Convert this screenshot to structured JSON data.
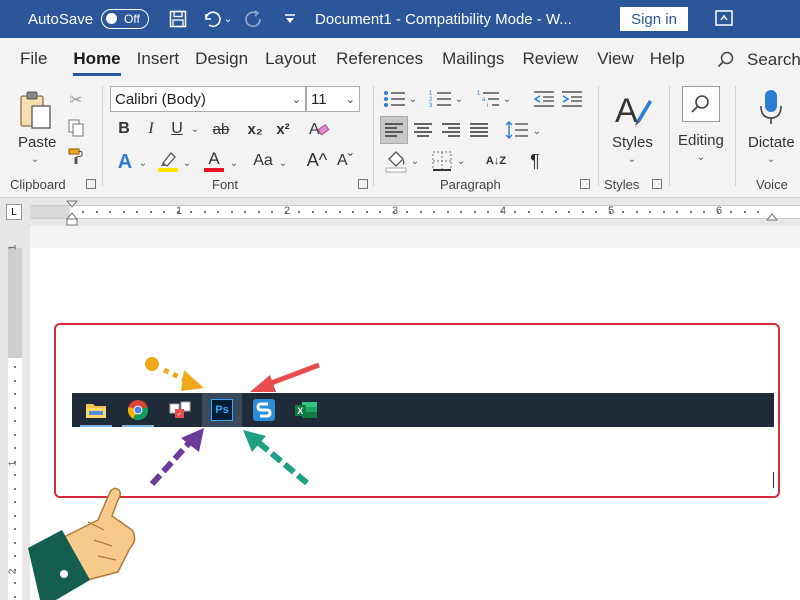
{
  "titlebar": {
    "autosave_label": "AutoSave",
    "autosave_state": "Off",
    "document_title": "Document1  -  Compatibility Mode  -  W...",
    "signin_label": "Sign in"
  },
  "tabs": {
    "items": [
      "File",
      "Home",
      "Insert",
      "Design",
      "Layout",
      "References",
      "Mailings",
      "Review",
      "View",
      "Help"
    ],
    "active": "Home",
    "search_label": "Search"
  },
  "ribbon": {
    "clipboard": {
      "label": "Clipboard",
      "paste_label": "Paste"
    },
    "font": {
      "label": "Font",
      "font_name": "Calibri (Body)",
      "font_size": "11",
      "bold": "B",
      "italic": "I",
      "underline": "U",
      "strike": "ab",
      "subscript": "x₂",
      "superscript": "x²",
      "font_color_glyph": "A",
      "case_glyph": "Aa",
      "grow_glyph": "A^",
      "shrink_glyph": "Aˇ"
    },
    "paragraph": {
      "label": "Paragraph",
      "sort_glyph": "A↓Z",
      "pilcrow": "¶"
    },
    "styles": {
      "label": "Styles",
      "button_label": "Styles"
    },
    "editing": {
      "button_label": "Editing"
    },
    "voice": {
      "label": "Voice",
      "button_label": "Dictate"
    }
  },
  "ruler": {
    "numbers": [
      "1",
      "2",
      "3",
      "4",
      "5",
      "6"
    ],
    "vertical_numbers": [
      "1",
      "1",
      "2"
    ]
  },
  "taskbar": {
    "apps": [
      "file-explorer",
      "chrome",
      "app-3",
      "photoshop",
      "snagit",
      "excel"
    ],
    "ps_label": "Ps",
    "excel_label": "X"
  },
  "colors": {
    "word_blue": "#2b579a",
    "highlight_red": "#d62b3a",
    "arrow_red": "#e84c4c",
    "arrow_orange": "#f0a81c",
    "arrow_purple": "#6a3b9a",
    "arrow_teal": "#1fa085",
    "taskbar": "#1f2b38"
  }
}
